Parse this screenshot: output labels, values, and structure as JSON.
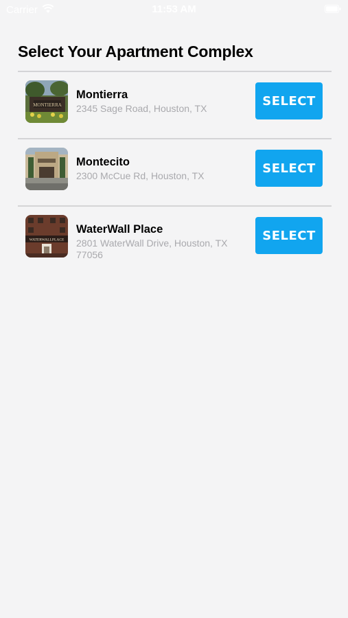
{
  "status_bar": {
    "carrier": "Carrier",
    "time": "11:53 AM",
    "icons": [
      "wifi-icon",
      "battery-icon"
    ]
  },
  "page": {
    "title": "Select Your Apartment Complex"
  },
  "complexes": [
    {
      "name": "Montierra",
      "address": "2345 Sage Road, Houston, TX",
      "button_label": "SELECT",
      "thumbnail": "montierra-photo"
    },
    {
      "name": "Montecito",
      "address": "2300 McCue Rd, Houston, TX",
      "button_label": "SELECT",
      "thumbnail": "montecito-photo"
    },
    {
      "name": "WaterWall Place",
      "address": "2801 WaterWall Drive, Houston, TX 77056",
      "button_label": "SELECT",
      "thumbnail": "waterwall-place-photo"
    }
  ],
  "colors": {
    "background": "#f4f4f5",
    "accent": "#11a5ef",
    "divider": "#d4d4d6",
    "secondary_text": "#a9a9ad"
  }
}
